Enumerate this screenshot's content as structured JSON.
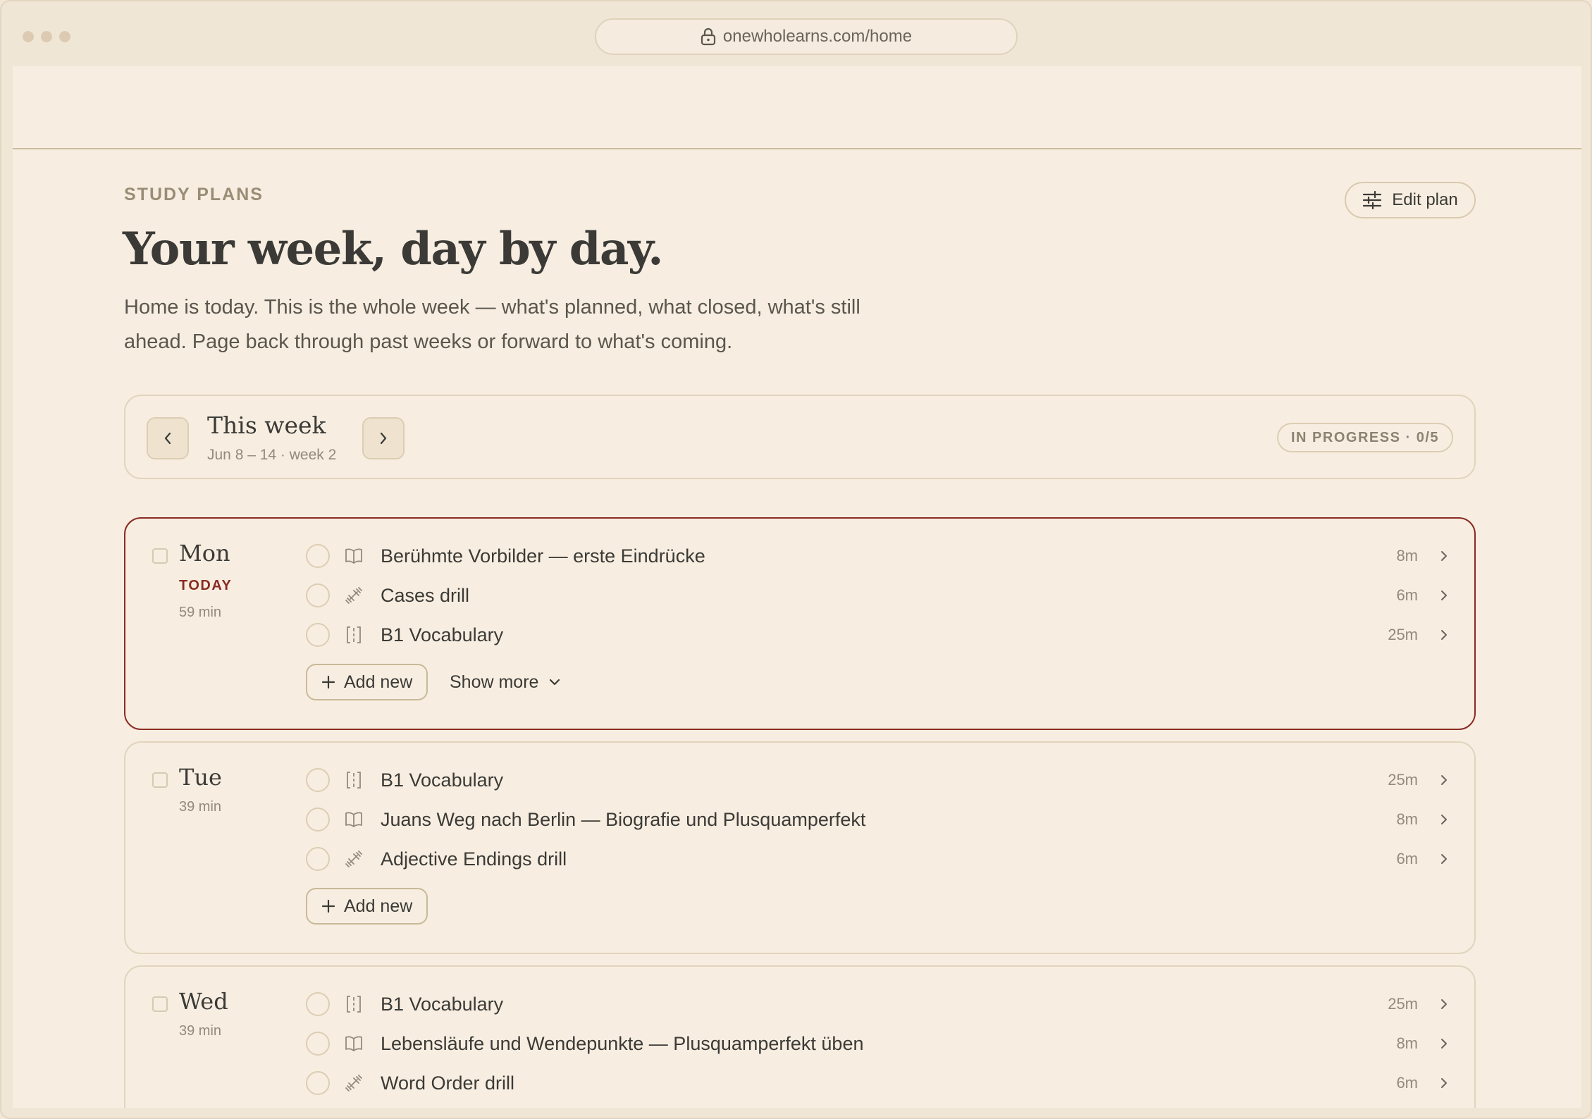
{
  "browser": {
    "url": "onewholearns.com/home"
  },
  "header": {
    "eyebrow": "STUDY PLANS",
    "title": "Your week, day by day.",
    "description": "Home is today. This is the whole week — what's planned, what closed, what's still ahead. Page back through past weeks or forward to what's coming.",
    "edit_label": "Edit plan"
  },
  "week": {
    "title": "This week",
    "subtitle": "Jun 8 – 14 · week 2",
    "status": "IN PROGRESS · 0/5"
  },
  "actions": {
    "add_new": "Add new",
    "show_more": "Show more"
  },
  "days": [
    {
      "name": "Mon",
      "today_label": "TODAY",
      "minutes": "59 min",
      "tasks": [
        {
          "icon": "book-icon",
          "name": "Berühmte Vorbilder — erste Eindrücke",
          "duration": "8m"
        },
        {
          "icon": "dumbbell-icon",
          "name": "Cases drill",
          "duration": "6m"
        },
        {
          "icon": "flashcards-icon",
          "name": "B1 Vocabulary",
          "duration": "25m"
        }
      ]
    },
    {
      "name": "Tue",
      "minutes": "39 min",
      "tasks": [
        {
          "icon": "flashcards-icon",
          "name": "B1 Vocabulary",
          "duration": "25m"
        },
        {
          "icon": "book-icon",
          "name": "Juans Weg nach Berlin — Biografie und Plusquamperfekt",
          "duration": "8m"
        },
        {
          "icon": "dumbbell-icon",
          "name": "Adjective Endings drill",
          "duration": "6m"
        }
      ]
    },
    {
      "name": "Wed",
      "minutes": "39 min",
      "tasks": [
        {
          "icon": "flashcards-icon",
          "name": "B1 Vocabulary",
          "duration": "25m"
        },
        {
          "icon": "book-icon",
          "name": "Lebensläufe und Wendepunkte — Plusquamperfekt üben",
          "duration": "8m"
        },
        {
          "icon": "dumbbell-icon",
          "name": "Word Order drill",
          "duration": "6m"
        }
      ]
    }
  ]
}
